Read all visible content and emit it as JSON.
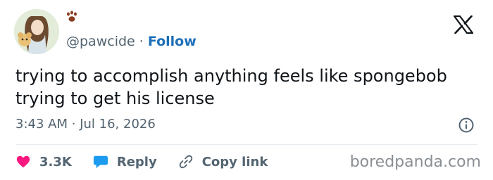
{
  "user": {
    "handle": "@pawcide",
    "separator": "·",
    "follow_label": "Follow"
  },
  "tweet": {
    "lines": [
      "trying to accomplish anything feels like spongebob",
      "trying to get his license"
    ],
    "time": "3:43 AM",
    "separator": "·",
    "date": "Jul 16, 2026"
  },
  "actions": {
    "likes": "3.3K",
    "reply_label": "Reply",
    "copy_label": "Copy link"
  },
  "watermark": "boredpanda.com",
  "icons": {
    "avatar": "avatar-image",
    "paw": "paw-icon",
    "x_logo": "x-logo-icon",
    "info": "info-icon",
    "like": "heart-icon",
    "reply": "speech-bubble-icon",
    "copy": "link-icon"
  },
  "colors": {
    "heart": "#f91880",
    "reply_bubble": "#1d9bf0",
    "follow": "#1d6fb8",
    "secondary_text": "#536471"
  }
}
